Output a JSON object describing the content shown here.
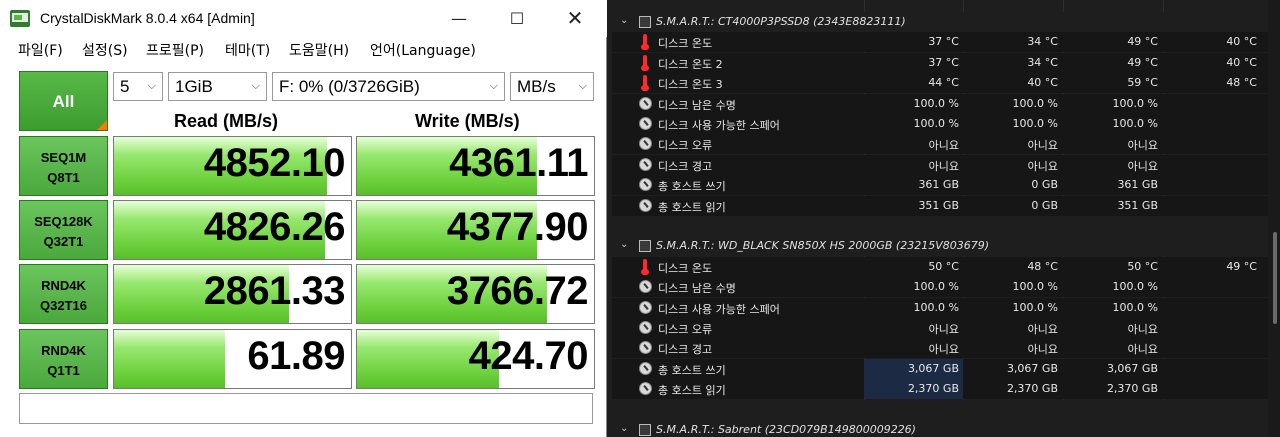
{
  "cdm": {
    "title": "CrystalDiskMark 8.0.4 x64 [Admin]",
    "window_controls": {
      "minimize": "—",
      "maximize": "☐",
      "close": "✕"
    },
    "menu": [
      "파일(F)",
      "설정(S)",
      "프로필(P)",
      "테마(T)",
      "도움말(H)",
      "언어(Language)"
    ],
    "all_button": "All",
    "selects": {
      "count": "5",
      "size": "1GiB",
      "drive": "F: 0% (0/3726GiB)",
      "unit": "MB/s"
    },
    "headers": {
      "read": "Read (MB/s)",
      "write": "Write (MB/s)"
    },
    "tests": [
      {
        "line1": "SEQ1M",
        "line2": "Q8T1",
        "read": "4852.10",
        "write": "4361.11",
        "read_level": 0.9,
        "write_level": 0.76
      },
      {
        "line1": "SEQ128K",
        "line2": "Q32T1",
        "read": "4826.26",
        "write": "4377.90",
        "read_level": 0.89,
        "write_level": 0.76
      },
      {
        "line1": "RND4K",
        "line2": "Q32T16",
        "read": "2861.33",
        "write": "3766.72",
        "read_level": 0.74,
        "write_level": 0.8
      },
      {
        "line1": "RND4K",
        "line2": "Q1T1",
        "read": "61.89",
        "write": "424.70",
        "read_level": 0.47,
        "write_level": 0.6
      }
    ],
    "comment": ""
  },
  "panel": {
    "rows": [
      {
        "type": "header",
        "label": "S.M.A.R.T.: CT4000P3PSSD8 (2343E8823111)"
      },
      {
        "type": "temp",
        "label": "디스크 온도",
        "v": [
          "37 °C",
          "34 °C",
          "49 °C",
          "40 °C"
        ]
      },
      {
        "type": "temp",
        "label": "디스크 온도 2",
        "v": [
          "37 °C",
          "34 °C",
          "49 °C",
          "40 °C"
        ]
      },
      {
        "type": "temp",
        "label": "디스크 온도 3",
        "v": [
          "44 °C",
          "40 °C",
          "59 °C",
          "48 °C"
        ]
      },
      {
        "type": "gauge",
        "label": "디스크 남은 수명",
        "v": [
          "100.0 %",
          "100.0 %",
          "100.0 %",
          ""
        ]
      },
      {
        "type": "gauge",
        "label": "디스크 사용 가능한 스페어",
        "v": [
          "100.0 %",
          "100.0 %",
          "100.0 %",
          ""
        ]
      },
      {
        "type": "gauge",
        "label": "디스크 오류",
        "v": [
          "아니요",
          "아니요",
          "아니요",
          ""
        ]
      },
      {
        "type": "gauge",
        "label": "디스크 경고",
        "v": [
          "아니요",
          "아니요",
          "아니요",
          ""
        ]
      },
      {
        "type": "gauge",
        "label": "총 호스트 쓰기",
        "v": [
          "361 GB",
          "0 GB",
          "361 GB",
          ""
        ]
      },
      {
        "type": "gauge",
        "label": "총 호스트 읽기",
        "v": [
          "351 GB",
          "0 GB",
          "351 GB",
          ""
        ]
      },
      {
        "type": "blank"
      },
      {
        "type": "header",
        "label": "S.M.A.R.T.: WD_BLACK SN850X HS 2000GB (23215V803679)"
      },
      {
        "type": "temp",
        "label": "디스크 온도",
        "v": [
          "50 °C",
          "48 °C",
          "50 °C",
          "49 °C"
        ]
      },
      {
        "type": "gauge",
        "label": "디스크 남은 수명",
        "v": [
          "100.0 %",
          "100.0 %",
          "100.0 %",
          ""
        ]
      },
      {
        "type": "gauge",
        "label": "디스크 사용 가능한 스페어",
        "v": [
          "100.0 %",
          "100.0 %",
          "100.0 %",
          ""
        ]
      },
      {
        "type": "gauge",
        "label": "디스크 오류",
        "v": [
          "아니요",
          "아니요",
          "아니요",
          ""
        ]
      },
      {
        "type": "gauge",
        "label": "디스크 경고",
        "v": [
          "아니요",
          "아니요",
          "아니요",
          ""
        ]
      },
      {
        "type": "gauge",
        "label": "총 호스트 쓰기",
        "v": [
          "3,067 GB",
          "3,067 GB",
          "3,067 GB",
          ""
        ],
        "highlight": true
      },
      {
        "type": "gauge",
        "label": "총 호스트 읽기",
        "v": [
          "2,370 GB",
          "2,370 GB",
          "2,370 GB",
          ""
        ],
        "highlight": true
      },
      {
        "type": "blank"
      },
      {
        "type": "header",
        "label": "S.M.A.R.T.: Sabrent (23CD079B149800009226)"
      }
    ]
  }
}
